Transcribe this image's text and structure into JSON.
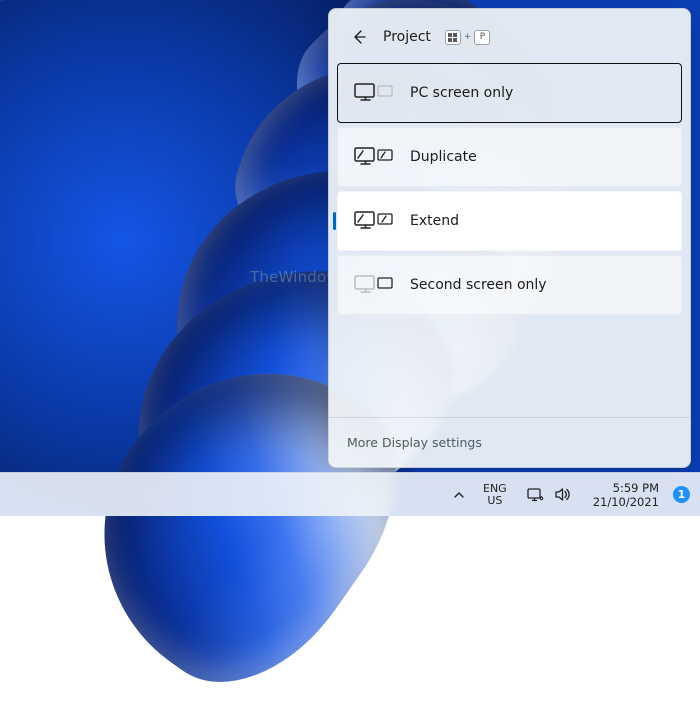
{
  "flyout": {
    "title": "Project",
    "shortcut": {
      "plus": "+",
      "key": "P"
    },
    "options": [
      {
        "id": "pc-only",
        "label": "PC screen only"
      },
      {
        "id": "duplicate",
        "label": "Duplicate"
      },
      {
        "id": "extend",
        "label": "Extend"
      },
      {
        "id": "second-only",
        "label": "Second screen only"
      }
    ],
    "state": {
      "focused": "pc-only",
      "selected": "extend"
    },
    "more_link": "More Display settings"
  },
  "taskbar": {
    "language": {
      "line1": "ENG",
      "line2": "US"
    },
    "clock": {
      "time": "5:59 PM",
      "date": "21/10/2021"
    },
    "notifications": "1"
  },
  "watermark": "TheWindowsClub"
}
